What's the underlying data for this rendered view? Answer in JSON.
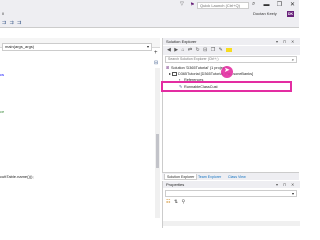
{
  "titlebar": {
    "quick_launch_placeholder": "Quick Launch (Ctrl+Q)",
    "minimize": "▬",
    "restore": "❐",
    "close": "✕"
  },
  "menubar": {
    "user_name": "Doctan Keely",
    "user_badge": "DK",
    "fragment": "ll"
  },
  "editor": {
    "member_dropdown": "main(args_args)",
    "code_lines": [
      {
        "text": "cs",
        "style": "blue"
      },
      {
        "text": "ce",
        "style": "green"
      },
      {
        "text": "cuttTable.name()));",
        "style": "plain"
      }
    ]
  },
  "solution_explorer": {
    "title": "Solution Explorer",
    "pin": "▾",
    "dock": "⊓",
    "close": "✕",
    "search_placeholder": "Search Solution Explorer (Ctrl+;)",
    "tree": [
      {
        "label": "Solution 'D365Tutorial' (1 project)",
        "indent": 0,
        "icon": "solution-icon"
      },
      {
        "label": "D365Tutorial [D365Tutorial_Pa...soneBanks]",
        "indent": 1,
        "icon": "project-icon"
      },
      {
        "label": "References",
        "indent": 2,
        "icon": "references-icon"
      },
      {
        "label": "RunnableClassCust",
        "indent": 2,
        "icon": "class-icon"
      }
    ],
    "tabs": [
      "Solution Explorer",
      "Team Explorer",
      "Class View"
    ]
  },
  "properties": {
    "title": "Properties",
    "pin": "▾",
    "dock": "⊓",
    "close": "✕"
  }
}
